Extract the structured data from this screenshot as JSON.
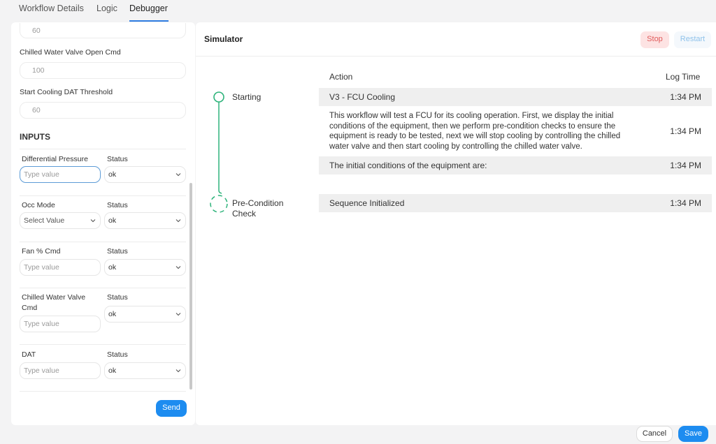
{
  "tabs": [
    {
      "label": "Workflow Details"
    },
    {
      "label": "Logic"
    },
    {
      "label": "Debugger"
    }
  ],
  "parameters": {
    "first_value": "60",
    "items": [
      {
        "label": "Chilled Water Valve Open Cmd",
        "value": "100"
      },
      {
        "label": "Start Cooling DAT Threshold",
        "value": "60"
      }
    ]
  },
  "inputs": {
    "title": "INPUTS",
    "status_label": "Status",
    "fields": [
      {
        "label": "Differential Pressure",
        "placeholder": "Type value",
        "status": "ok"
      },
      {
        "label": "Occ Mode",
        "placeholder": "Select Value",
        "status": "ok"
      },
      {
        "label": "Fan % Cmd",
        "placeholder": "Type value",
        "status": "ok"
      },
      {
        "label": "Chilled Water Valve",
        "label_line2": "Cmd",
        "placeholder": "Type value",
        "status": "ok"
      },
      {
        "label": "DAT",
        "placeholder": "Type value",
        "status": "ok"
      }
    ],
    "send_label": "Send"
  },
  "simulator": {
    "title": "Simulator",
    "stop_label": "Stop",
    "restart_label": "Restart",
    "columns": {
      "action": "Action",
      "log_time": "Log Time"
    },
    "steps": [
      {
        "label": "Starting",
        "status": "complete"
      },
      {
        "label": "Pre-Condition",
        "label_line2": "Check",
        "status": "in-progress"
      }
    ],
    "log": [
      {
        "action": "V3 - FCU Cooling",
        "time": "1:34 PM"
      },
      {
        "action_lines": [
          "This workflow will test a FCU for its cooling operation. First, we display the initial",
          "conditions of the equipment, then we perform pre-condition checks to ensure the",
          "equipment is ready to be tested, next we will stop cooling by controlling the chilled",
          "water valve and then start cooling by controlling the chilled water valve."
        ],
        "time": "1:34 PM"
      },
      {
        "action": "The initial conditions of the equipment are:",
        "time": "1:34 PM"
      },
      {
        "action": "Sequence Initialized",
        "time": "1:34 PM"
      }
    ]
  },
  "footer": {
    "cancel_label": "Cancel",
    "save_label": "Save"
  },
  "colors": {
    "accent": "#1d8cf0",
    "step_green": "#2db37a",
    "stop_red": "#e05a5a"
  },
  "icons": {
    "select_chevron": "chevron-down-icon",
    "step_done": "circle-outline-icon",
    "step_pending": "dashed-circle-icon"
  }
}
